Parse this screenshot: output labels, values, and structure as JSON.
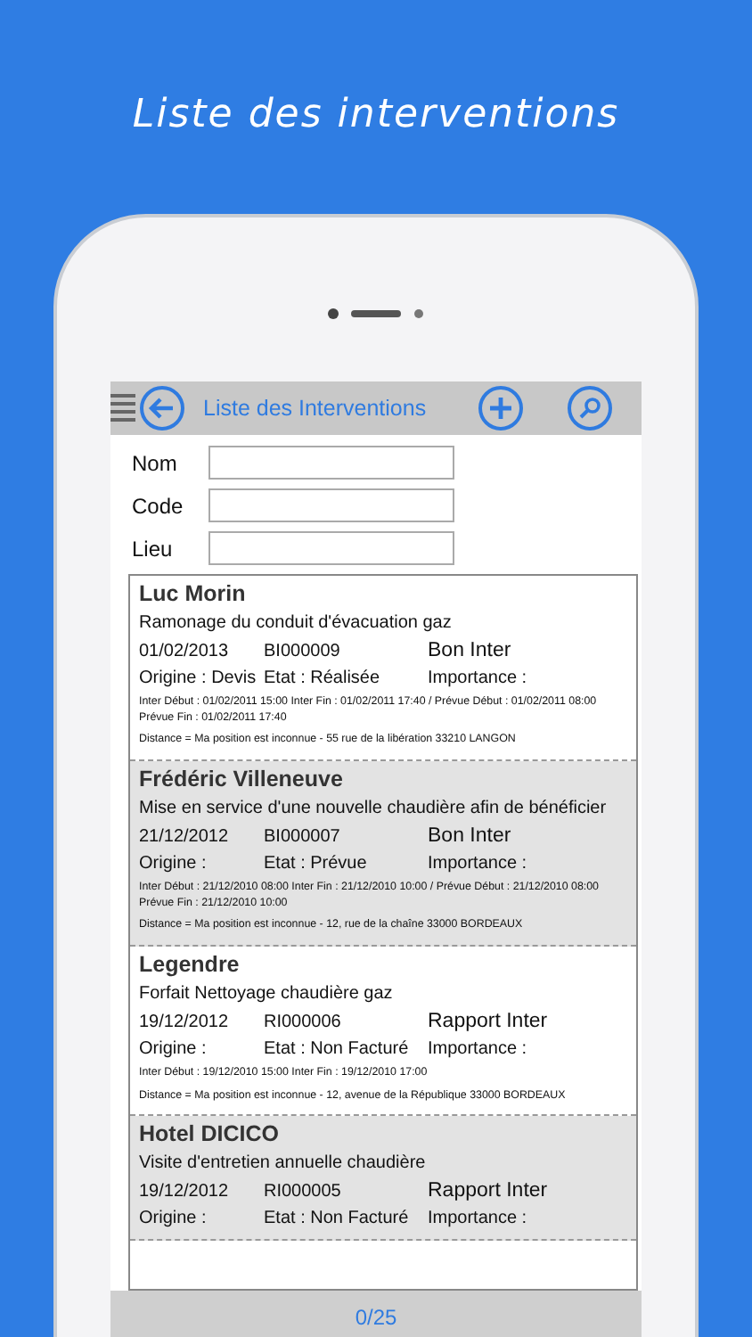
{
  "headline": "Liste des interventions",
  "nav_bar": {
    "title": "Liste des Interventions"
  },
  "search_form": [
    {
      "label": "Nom"
    },
    {
      "label": "Code"
    },
    {
      "label": "Lieu"
    }
  ],
  "interventions": [
    {
      "client": "Luc Morin",
      "description": "Ramonage du conduit d'évacuation gaz",
      "date": "01/02/2013",
      "code": "BI000009",
      "type": "Bon Inter",
      "origine": "Origine : Devis",
      "etat": "Etat : Réalisée",
      "importance": "Importance :",
      "schedule": "Inter Début : 01/02/2011 15:00 Inter Fin : 01/02/2011 17:40  / Prévue Début : 01/02/2011 08:00 Prévue Fin : 01/02/2011 17:40",
      "distance": "Distance = Ma position est inconnue - 55 rue de la libération 33210 LANGON"
    },
    {
      "client": "Frédéric Villeneuve",
      "description": "Mise en service d'une nouvelle chaudière afin de bénéficier",
      "date": "21/12/2012",
      "code": "BI000007",
      "type": "Bon Inter",
      "origine": "Origine :",
      "etat": "Etat : Prévue",
      "importance": "Importance :",
      "schedule": "Inter Début : 21/12/2010 08:00 Inter Fin : 21/12/2010 10:00  / Prévue Début : 21/12/2010 08:00 Prévue Fin : 21/12/2010 10:00",
      "distance": "Distance = Ma position est inconnue - 12, rue de la chaîne 33000 BORDEAUX"
    },
    {
      "client": "Legendre",
      "description": "Forfait Nettoyage chaudière gaz",
      "date": "19/12/2012",
      "code": "RI000006",
      "type": "Rapport Inter",
      "origine": "Origine :",
      "etat": "Etat : Non Facturé",
      "importance": "Importance :",
      "schedule": "Inter Début : 19/12/2010 15:00 Inter Fin : 19/12/2010 17:00",
      "distance": "Distance = Ma position est inconnue - 12, avenue de la République 33000 BORDEAUX"
    },
    {
      "client": "Hotel DICICO",
      "description": "Visite d'entretien annuelle chaudière",
      "date": "19/12/2012",
      "code": "RI000005",
      "type": "Rapport Inter",
      "origine": "Origine :",
      "etat": "Etat : Non Facturé",
      "importance": "Importance :"
    }
  ],
  "footer": {
    "counter": "0/25"
  }
}
